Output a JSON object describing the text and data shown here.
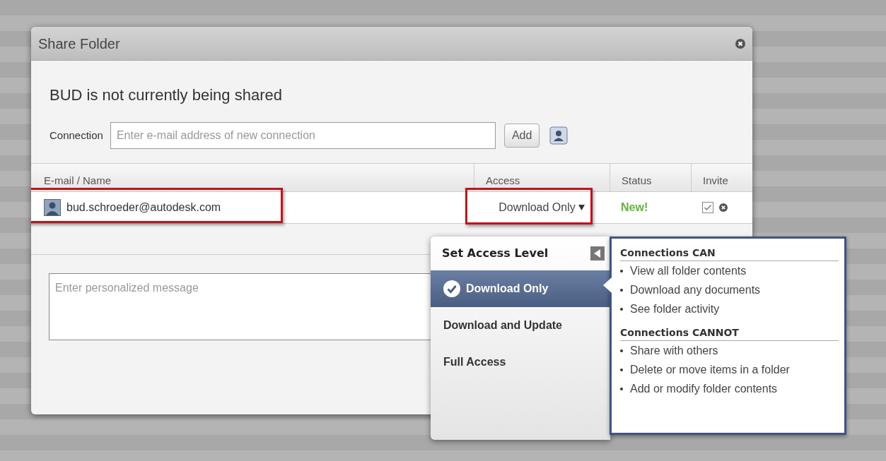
{
  "dialog": {
    "title": "Share Folder",
    "heading": "BUD is not currently being shared",
    "connection": {
      "label": "Connection",
      "placeholder": "Enter e-mail address of new connection",
      "add_button": "Add"
    },
    "table": {
      "columns": [
        "E-mail / Name",
        "Access",
        "Status",
        "Invite"
      ],
      "rows": [
        {
          "email": "bud.schroeder@autodesk.com",
          "access": "Download Only",
          "status": "New!",
          "invite_checked": true,
          "highlighted": true
        }
      ]
    },
    "message": {
      "placeholder": "Enter personalized message"
    }
  },
  "access_menu": {
    "title": "Set Access Level",
    "options": [
      {
        "label": "Download Only",
        "selected": true
      },
      {
        "label": "Download and Update",
        "selected": false
      },
      {
        "label": "Full Access",
        "selected": false
      }
    ],
    "details": [
      {
        "heading": "Connections CAN",
        "items": [
          "View all folder contents",
          "Download any documents",
          "See folder activity"
        ]
      },
      {
        "heading": "Connections CANNOT",
        "items": [
          "Share with others",
          "Delete or move items in a folder",
          "Add or modify folder contents"
        ]
      }
    ]
  }
}
